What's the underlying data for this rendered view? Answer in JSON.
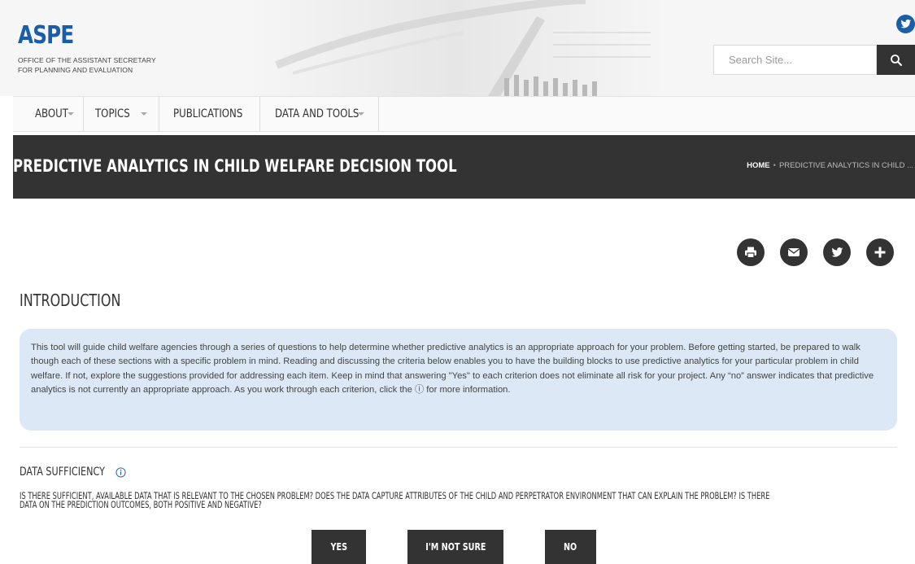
{
  "header": {
    "logo_title": "ASPE",
    "logo_subtitle_line1": "OFFICE OF THE ASSISTANT SECRETARY",
    "logo_subtitle_line2": "FOR PLANNING AND EVALUATION",
    "search_placeholder": "Search Site...",
    "icons": {
      "social": "twitter-icon",
      "search": "search-icon"
    }
  },
  "nav": {
    "items": [
      {
        "label": "ABOUT",
        "has_dropdown": true
      },
      {
        "label": "TOPICS",
        "has_dropdown": true
      },
      {
        "label": "PUBLICATIONS",
        "has_dropdown": false
      },
      {
        "label": "DATA AND TOOLS",
        "has_dropdown": true
      }
    ]
  },
  "title_bar": {
    "title": "PREDICTIVE ANALYTICS IN CHILD WELFARE DECISION TOOL",
    "breadcrumb_home": "HOME",
    "breadcrumb_separator": "•",
    "breadcrumb_current": "PREDICTIVE ANALYTICS IN CHILD ..."
  },
  "share_icons": [
    "print-icon",
    "email-icon",
    "twitter-icon",
    "plus-icon"
  ],
  "intro": {
    "heading": "INTRODUCTION",
    "text": "This tool will guide child welfare agencies through a series of questions to help determine whether predictive analytics is an appropriate approach for your problem. Before getting started, be prepared to walk though each of these sections with a specific problem in mind. Reading and discussing the criteria below enables you to have the building blocks to use predictive analytics for your particular problem in child welfare. If not, explore the suggestions provided for addressing each item. Keep in mind that answering \"Yes\" to each criterion does not eliminate all risk for your project. Any “no” answer indicates that predictive analytics is not currently an appropriate approach. As you work through each criterion, click the ⓘ for more information."
  },
  "data_sufficiency": {
    "heading": "DATA SUFFICIENCY",
    "question_line1": "IS THERE SUFFICIENT, AVAILABLE DATA THAT IS RELEVANT TO THE CHOSEN PROBLEM? DOES THE DATA CAPTURE ATTRIBUTES OF THE CHILD AND PERPETRATOR ENVIRONMENT THAT CAN EXPLAIN THE PROBLEM? IS THERE",
    "question_line2": "DATA ON THE PREDICTION OUTCOMES, BOTH POSITIVE AND NEGATIVE?",
    "buttons": {
      "yes": "YES",
      "not_sure": "I'M NOT SURE",
      "no": "NO"
    }
  },
  "colors": {
    "brand_blue": "#1a5da8",
    "dark_bar": "#333333",
    "intro_bg": "#dce8f6"
  }
}
